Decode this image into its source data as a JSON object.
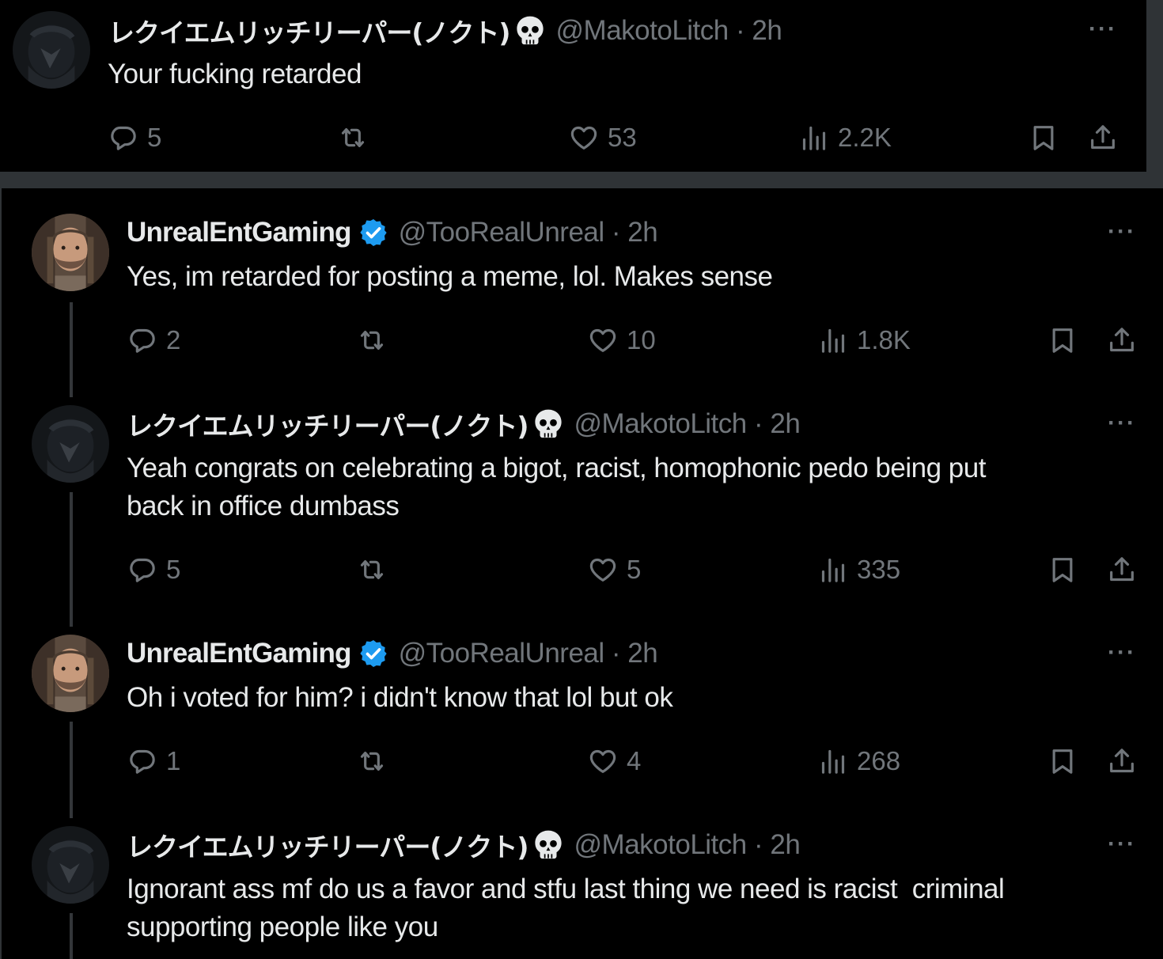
{
  "tweets": [
    {
      "name": "レクイエムリッチリーパー(ノクト)",
      "handle": "@MakotoLitch",
      "time": "2h",
      "separator": "·",
      "text": "Your fucking retarded",
      "reply_count": "5",
      "like_count": "53",
      "view_count": "2.2K",
      "verified": false,
      "name_emoji": "skull-icon"
    },
    {
      "name": "UnrealEntGaming",
      "handle": "@TooRealUnreal",
      "time": "2h",
      "separator": "·",
      "text": "Yes, im retarded for posting a meme, lol. Makes sense",
      "reply_count": "2",
      "like_count": "10",
      "view_count": "1.8K",
      "verified": true
    },
    {
      "name": "レクイエムリッチリーパー(ノクト)",
      "handle": "@MakotoLitch",
      "time": "2h",
      "separator": "·",
      "text": "Yeah congrats on celebrating a bigot, racist, homophonic pedo being put\nback in office dumbass",
      "reply_count": "5",
      "like_count": "5",
      "view_count": "335",
      "verified": false,
      "name_emoji": "skull-icon"
    },
    {
      "name": "UnrealEntGaming",
      "handle": "@TooRealUnreal",
      "time": "2h",
      "separator": "·",
      "text": "Oh i voted for him? i didn't know that lol but ok",
      "reply_count": "1",
      "like_count": "4",
      "view_count": "268",
      "verified": true
    },
    {
      "name": "レクイエムリッチリーパー(ノクト)",
      "handle": "@MakotoLitch",
      "time": "2h",
      "separator": "·",
      "text": "Ignorant ass mf do us a favor and stfu last thing we need is racist  criminal\nsupporting people like you",
      "verified": false,
      "name_emoji": "skull-icon"
    }
  ],
  "more_label": "···",
  "colors": {
    "background": "#000000",
    "text": "#e7e9ea",
    "muted": "#71767b",
    "verified_blue": "#1d9bf0",
    "divider": "#2f3336"
  }
}
